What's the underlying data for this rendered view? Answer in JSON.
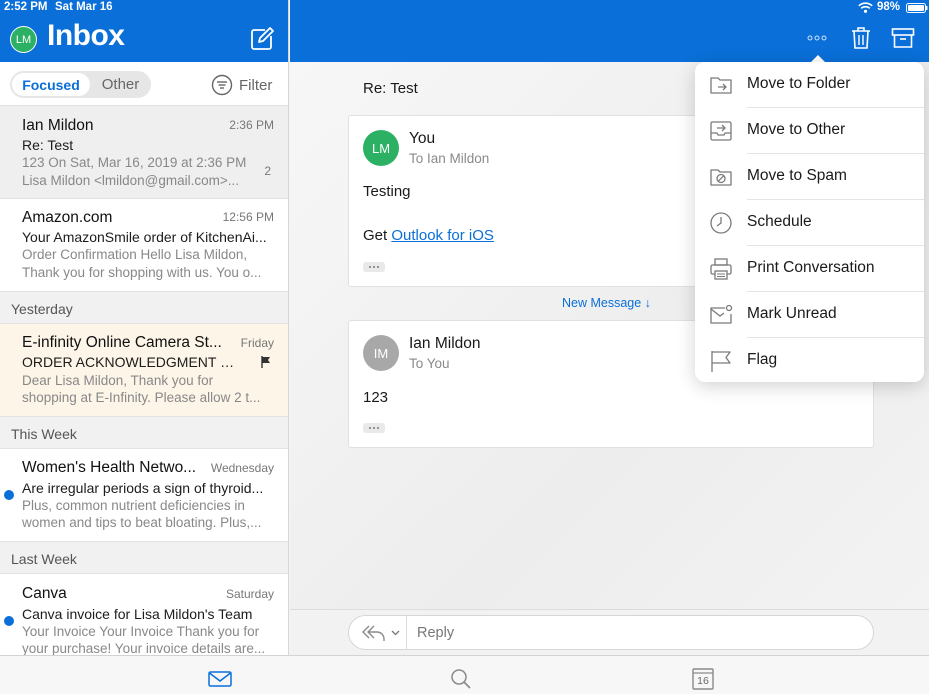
{
  "status": {
    "time": "2:52 PM",
    "date": "Sat Mar 16",
    "battery": "98%"
  },
  "left": {
    "avatar_initials": "LM",
    "title": "Inbox",
    "tabs": {
      "focused": "Focused",
      "other": "Other"
    },
    "filter_label": "Filter"
  },
  "mails": [
    {
      "from": "Ian Mildon",
      "time": "2:36 PM",
      "subject": "Re: Test",
      "preview1": "123 On Sat, Mar 16, 2019 at 2:36 PM",
      "preview2": "Lisa Mildon <lmildon@gmail.com>...",
      "count": "2"
    },
    {
      "from": "Amazon.com",
      "time": "12:56 PM",
      "subject": "Your AmazonSmile order of KitchenAi...",
      "preview1": "Order Confirmation Hello Lisa Mildon,",
      "preview2": "Thank you for shopping with us. You o..."
    },
    {
      "from": "E-infinity Online Camera St...",
      "time": "Friday",
      "subject": "ORDER ACKNOWLEDGMENT #8...",
      "preview1": "Dear Lisa Mildon, Thank you for",
      "preview2": "shopping at E-Infinity. Please allow 2 t..."
    },
    {
      "from": "Women's Health Netwo...",
      "time": "Wednesday",
      "subject": "Are irregular periods a sign of thyroid...",
      "preview1": "Plus, common nutrient deficiencies in",
      "preview2": "women and tips to beat bloating. Plus,..."
    },
    {
      "from": "Canva",
      "time": "Saturday",
      "subject": "Canva invoice for Lisa Mildon's Team",
      "preview1": "Your Invoice Your Invoice Thank you for",
      "preview2": "your purchase! Your invoice details are..."
    }
  ],
  "sections": {
    "yesterday": "Yesterday",
    "this_week": "This Week",
    "last_week": "Last Week"
  },
  "thread": {
    "subject": "Re: Test",
    "msg1": {
      "initials": "LM",
      "sender": "You",
      "to": "To Ian Mildon",
      "line1": "Testing",
      "line2_prefix": "Get ",
      "link": "Outlook for iOS"
    },
    "new_message": "New Message ↓",
    "msg2": {
      "initials": "IM",
      "sender": "Ian Mildon",
      "to": "To You",
      "line1": "123"
    }
  },
  "reply": {
    "placeholder": "Reply"
  },
  "menu": {
    "items": [
      {
        "label": "Move to Folder",
        "icon": "folder-move-icon"
      },
      {
        "label": "Move to Other",
        "icon": "inbox-tray-icon"
      },
      {
        "label": "Move to Spam",
        "icon": "spam-block-icon"
      },
      {
        "label": "Schedule",
        "icon": "clock-icon"
      },
      {
        "label": "Print Conversation",
        "icon": "printer-icon"
      },
      {
        "label": "Mark Unread",
        "icon": "envelope-unread-icon"
      },
      {
        "label": "Flag",
        "icon": "flag-icon"
      }
    ]
  },
  "tabbar": {
    "calendar_day": "16"
  },
  "colors": {
    "brand": "#0a6fd8",
    "avatar_me": "#2cb064",
    "avatar_other": "#a8a8a8",
    "selected_row": "#efefef",
    "flagged_row": "#fdf5e8"
  }
}
